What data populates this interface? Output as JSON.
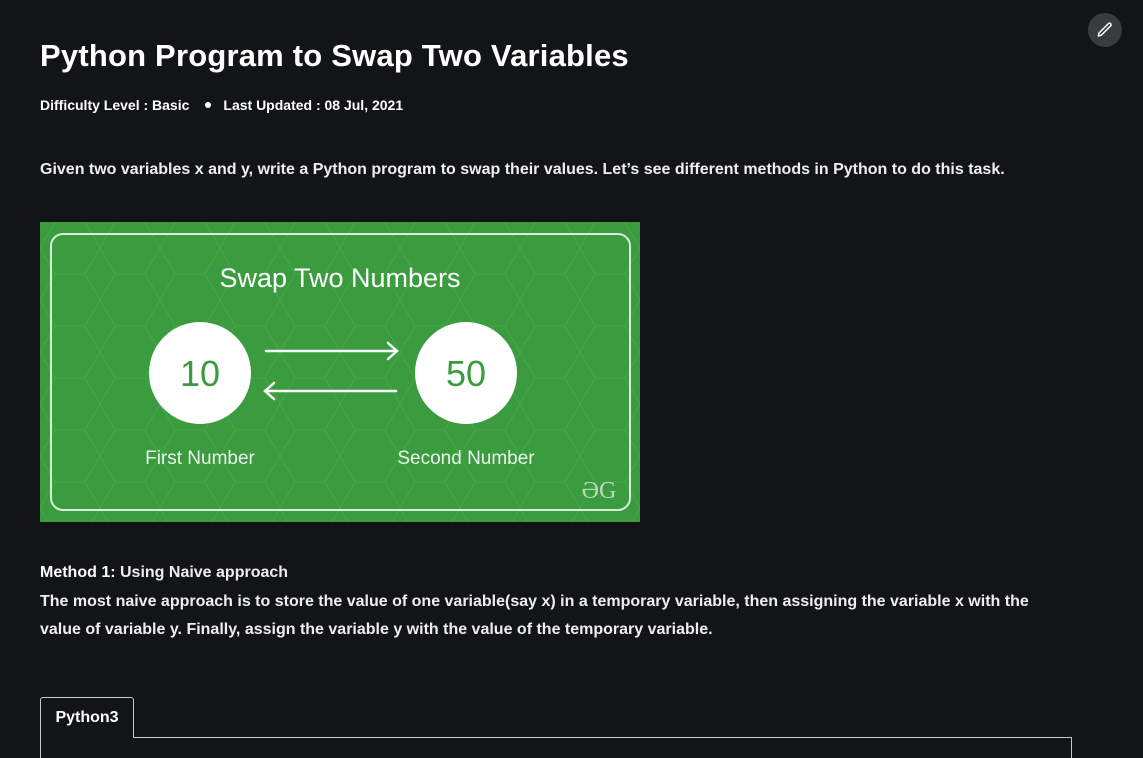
{
  "article": {
    "title": "Python Program to Swap Two Variables",
    "difficulty": "Difficulty Level : Basic",
    "updated": "Last Updated : 08 Jul, 2021",
    "intro": "Given two variables x and y, write a Python program to swap their values. Let’s see different methods in Python to do this task."
  },
  "banner": {
    "heading": "Swap Two Numbers",
    "first_value": "10",
    "second_value": "50",
    "first_label": "First Number",
    "second_label": "Second Number",
    "logo_text": "ƏG",
    "colors": {
      "green": "#3a9b3f",
      "number_text": "#3a9b3f"
    }
  },
  "method1": {
    "label": "Method 1:",
    "name": " Using Naive approach",
    "description": "The most naive approach is to store the value of one variable(say x) in a temporary variable, then assigning the variable x with the value of variable y. Finally, assign the variable y with the value of the temporary variable."
  },
  "code_tabs": [
    {
      "label": "Python3"
    }
  ],
  "icons": {
    "edit": "pencil-icon"
  }
}
